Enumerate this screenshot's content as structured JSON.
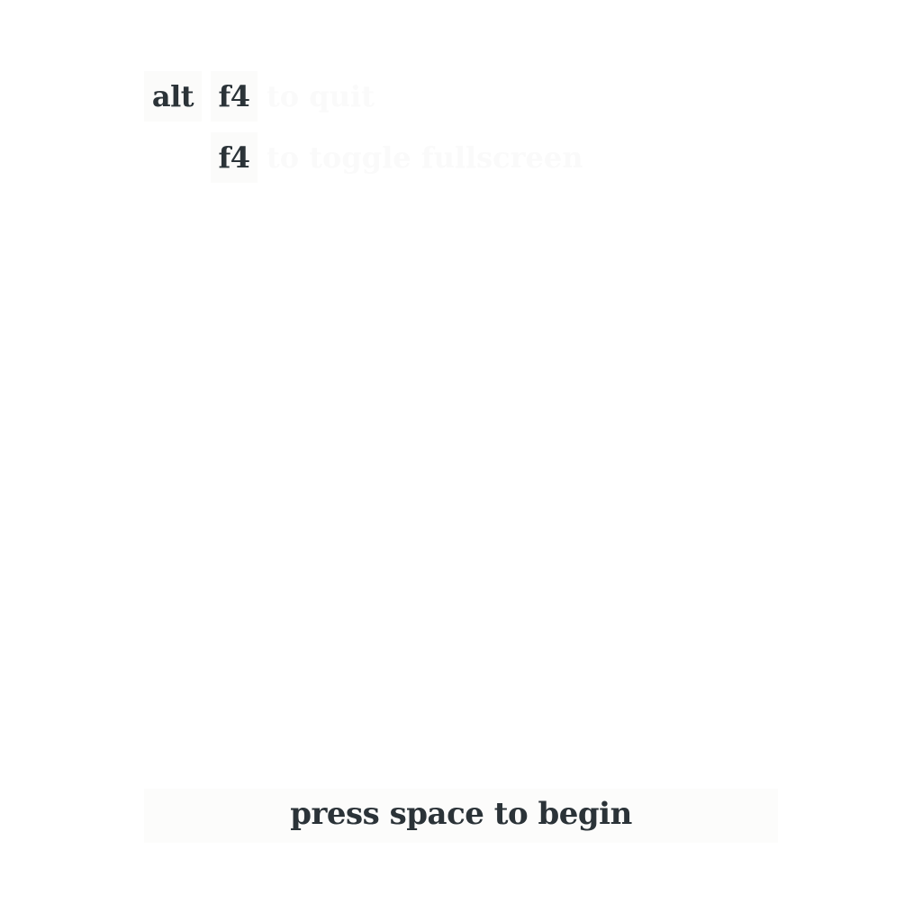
{
  "controls": [
    {
      "keys": [
        "alt",
        "f4"
      ],
      "description": "to quit"
    },
    {
      "keys": [
        "f4"
      ],
      "description": "to toggle fullscreen"
    }
  ],
  "prompt": "press space to begin",
  "colors": {
    "text": "#2b3338",
    "key_background": "#fbfbfa",
    "faded_text": "#fafafa",
    "background": "#ffffff"
  }
}
